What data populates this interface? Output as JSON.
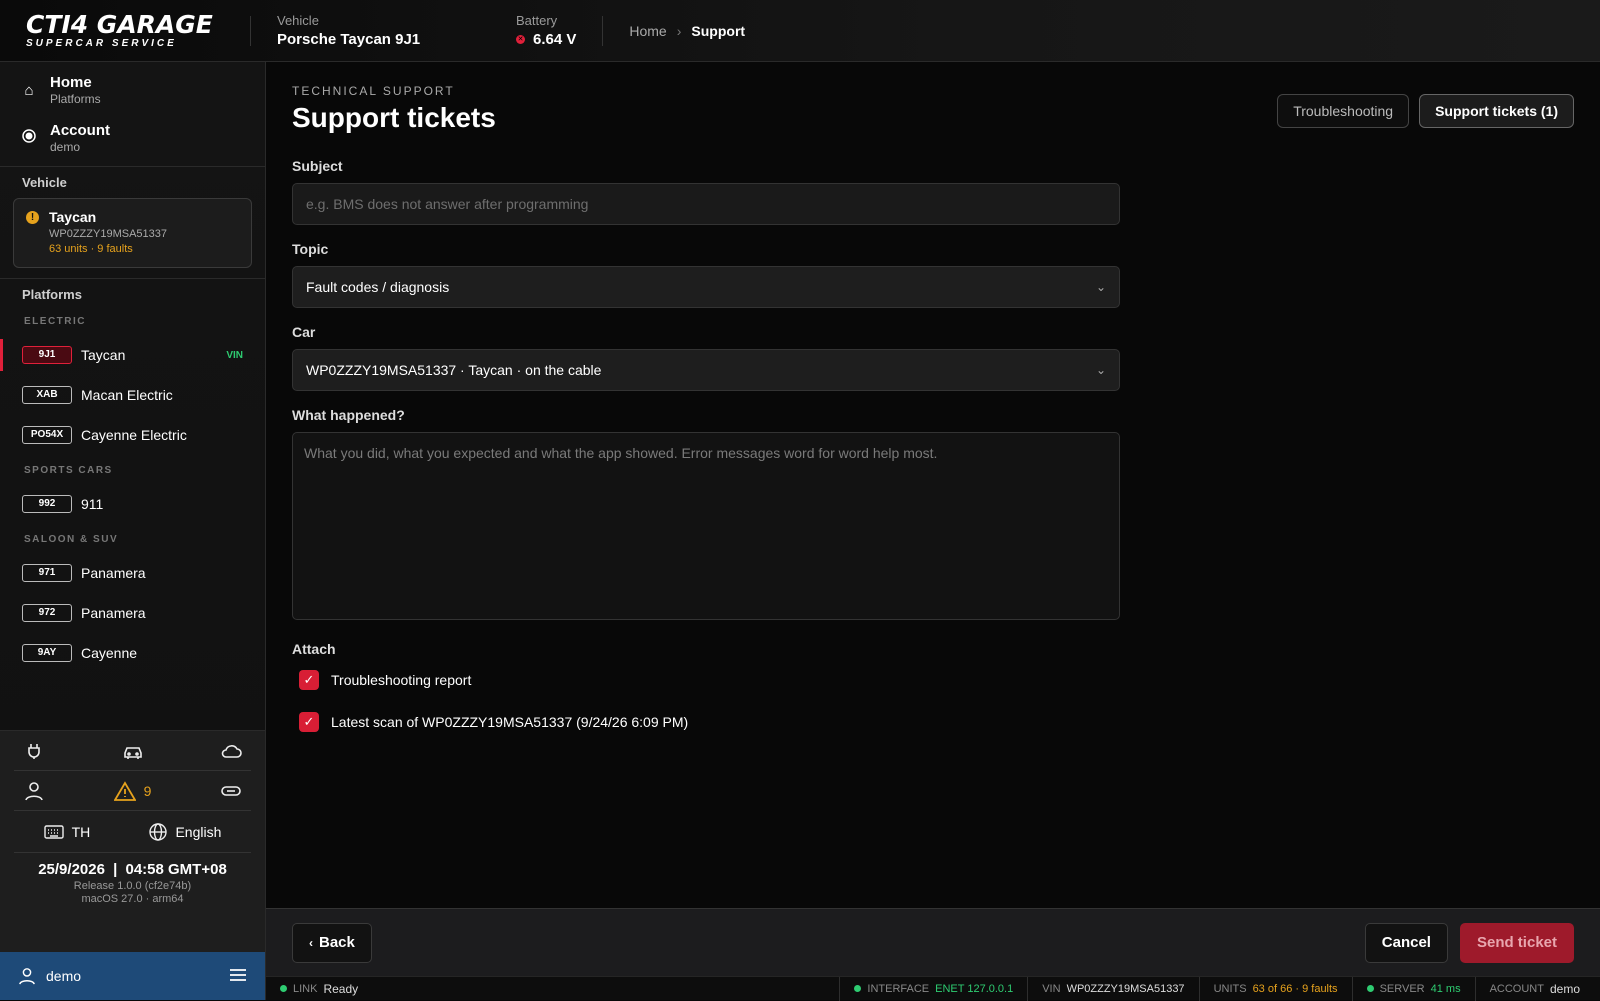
{
  "brand": {
    "name": "CTI4 GARAGE",
    "tagline": "SUPERCAR SERVICE"
  },
  "topbar": {
    "vehicle_label": "Vehicle",
    "vehicle_value": "Porsche Taycan 9J1",
    "battery_label": "Battery",
    "battery_value": "6.64 V",
    "breadcrumb": {
      "home": "Home",
      "separator": "›",
      "current": "Support"
    }
  },
  "sidebar": {
    "nav": [
      {
        "title": "Home",
        "sub": "Platforms"
      },
      {
        "title": "Account",
        "sub": "demo"
      }
    ],
    "vehicle_section": "Vehicle",
    "vehicle_card": {
      "name": "Taycan",
      "vin": "WP0ZZZY19MSA51337",
      "status": "63 units · 9 faults"
    },
    "platforms_section": "Platforms",
    "groups": [
      {
        "title": "ELECTRIC",
        "items": [
          {
            "code": "9J1",
            "name": "Taycan",
            "badge": "VIN"
          },
          {
            "code": "XAB",
            "name": "Macan Electric",
            "badge": ""
          },
          {
            "code": "PO54X",
            "name": "Cayenne Electric",
            "badge": ""
          }
        ]
      },
      {
        "title": "SPORTS CARS",
        "items": [
          {
            "code": "992",
            "name": "911",
            "badge": ""
          }
        ]
      },
      {
        "title": "SALOON & SUV",
        "items": [
          {
            "code": "971",
            "name": "Panamera",
            "badge": ""
          },
          {
            "code": "972",
            "name": "Panamera",
            "badge": ""
          },
          {
            "code": "9AY",
            "name": "Cayenne",
            "badge": ""
          }
        ]
      }
    ],
    "bottom": {
      "icons_row1": [
        "plug-icon",
        "car-icon",
        "cloud-icon"
      ],
      "icons_row2": [
        "user-icon",
        "warning-icon",
        "link-icon"
      ],
      "warning_count": "9",
      "keyboard_layout": "TH",
      "language": "English",
      "date": "25/9/2026",
      "time": "04:58 GMT+08",
      "release": "Release 1.0.0 (cf2e74b)",
      "platform": "macOS 27.0 · arm64"
    },
    "user": "demo"
  },
  "main": {
    "eyebrow": "TECHNICAL SUPPORT",
    "title": "Support tickets",
    "tabs": [
      {
        "label": "Troubleshooting",
        "active": false
      },
      {
        "label": "Support tickets (1)",
        "active": true
      }
    ],
    "form": {
      "subject_label": "Subject",
      "subject_value": "",
      "subject_placeholder": "e.g. BMS does not answer after programming",
      "topic_label": "Topic",
      "topic_value": "Fault codes / diagnosis",
      "car_label": "Car",
      "car_value": "WP0ZZZY19MSA51337 · Taycan · on the cable",
      "what_label": "What happened?",
      "what_placeholder": "What you did, what you expected and what the app showed. Error messages word for word help most.",
      "attach_label": "Attach",
      "attachments": [
        {
          "label": "Troubleshooting report",
          "checked": true
        },
        {
          "label": "Latest scan of WP0ZZZY19MSA51337 (9/24/26 6:09 PM)",
          "checked": true
        }
      ]
    }
  },
  "footer": {
    "back": "Back",
    "cancel": "Cancel",
    "send": "Send ticket"
  },
  "statusbar": {
    "link_label": "LINK",
    "link_value": "Ready",
    "interface_label": "INTERFACE",
    "interface_value": "ENET 127.0.0.1",
    "vin_label": "VIN",
    "vin_value": "WP0ZZZY19MSA51337",
    "units_label": "UNITS",
    "units_value": "63 of 66 · 9 faults",
    "server_label": "SERVER",
    "server_value": "41 ms",
    "account_label": "ACCOUNT",
    "account_value": "demo"
  },
  "colors": {
    "accent": "#e0203a",
    "warning": "#e6a21d",
    "ok": "#2ecc71",
    "user_bar": "#1e4a78"
  }
}
